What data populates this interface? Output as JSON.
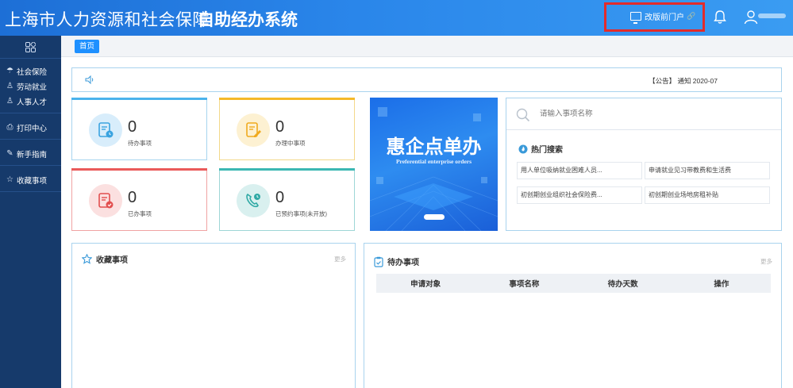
{
  "header": {
    "title_main": "上海市人力资源和社会保障",
    "title_sub": "自助经办系统",
    "portal_label": "改版前门户"
  },
  "sidebar": {
    "items": [
      {
        "label": "社会保险",
        "icon": "umbrella-icon"
      },
      {
        "label": "劳动就业",
        "icon": "person-icon"
      },
      {
        "label": "人事人才",
        "icon": "people-icon"
      },
      {
        "label": "打印中心",
        "icon": "printer-icon"
      },
      {
        "label": "新手指南",
        "icon": "guide-icon"
      },
      {
        "label": "收藏事项",
        "icon": "star-icon"
      }
    ]
  },
  "tabs": {
    "home": "首页"
  },
  "notice": {
    "text": "【公告】 通知 2020-07"
  },
  "stats": [
    {
      "count": "0",
      "label": "待办事项",
      "color": "#4ab3ec"
    },
    {
      "count": "0",
      "label": "办理中事项",
      "color": "#f5b92a"
    },
    {
      "count": "0",
      "label": "已办事项",
      "color": "#ea5a5a"
    },
    {
      "count": "0",
      "label": "已预约事项(未开放)",
      "color": "#3bb7b3"
    }
  ],
  "banner": {
    "title": "惠企点单办",
    "subtitle": "Preferential enterprise orders"
  },
  "search": {
    "placeholder": "请输入事项名称",
    "hot_title": "热门搜索",
    "hot_items": [
      "用人单位吸纳就业困难人员...",
      "申请就业见习带教费和生活费",
      "初创期创业组织社会保险费...",
      "初创期创业场地房租补贴"
    ]
  },
  "favorites": {
    "title": "收藏事项",
    "more": "更多"
  },
  "todo": {
    "title": "待办事项",
    "more": "更多",
    "columns": [
      "申请对象",
      "事项名称",
      "待办天数",
      "操作"
    ]
  },
  "colors": {
    "header_blue": "#2a86ea",
    "sidebar_navy": "#163a6b",
    "highlight_red": "#e32b2b"
  }
}
